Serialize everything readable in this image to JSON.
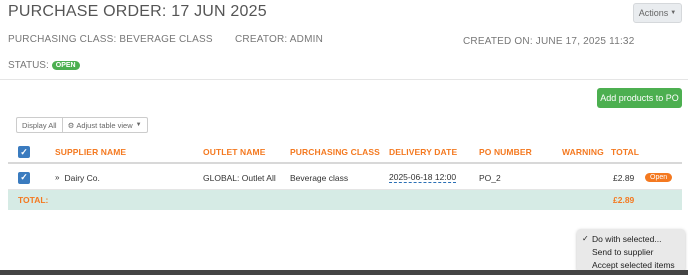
{
  "header": {
    "title": "PURCHASE ORDER: 17 JUN 2025",
    "actions_label": "Actions",
    "purchasing_class": "PURCHASING CLASS: BEVERAGE CLASS",
    "creator": "CREATOR: ADMIN",
    "created_on": "CREATED ON: JUNE 17, 2025 11:32",
    "status_label": "STATUS:",
    "status_value": "OPEN"
  },
  "toolbar": {
    "add_products_label": "Add products to PO",
    "display_all_label": "Display All",
    "adjust_view_label": "Adjust table view"
  },
  "table": {
    "headers": {
      "supplier_name": "SUPPLIER NAME",
      "outlet_name": "OUTLET NAME",
      "purchasing_class": "PURCHASING CLASS",
      "delivery_date": "DELIVERY DATE",
      "po_number": "PO NUMBER",
      "warning": "WARNING",
      "total": "TOTAL"
    },
    "rows": [
      {
        "supplier_name": "Dairy Co.",
        "outlet_name": "GLOBAL: Outlet All",
        "purchasing_class": "Beverage class",
        "delivery_date": "2025-06-18 12:00",
        "po_number": "PO_2",
        "warning": "",
        "total": "£2.89",
        "status": "Open"
      }
    ],
    "footer": {
      "label": "TOTAL:",
      "total": "£2.89"
    }
  },
  "dropdown": {
    "items": [
      {
        "label": "Do with selected...",
        "checked": true
      },
      {
        "label": "Send to supplier",
        "checked": false
      },
      {
        "label": "Accept selected items",
        "checked": false
      }
    ]
  },
  "colors": {
    "accent_orange": "#f47920",
    "success_green": "#4caf50",
    "checkbox_blue": "#3a7bbf",
    "total_row_bg": "#d6ebe5"
  }
}
